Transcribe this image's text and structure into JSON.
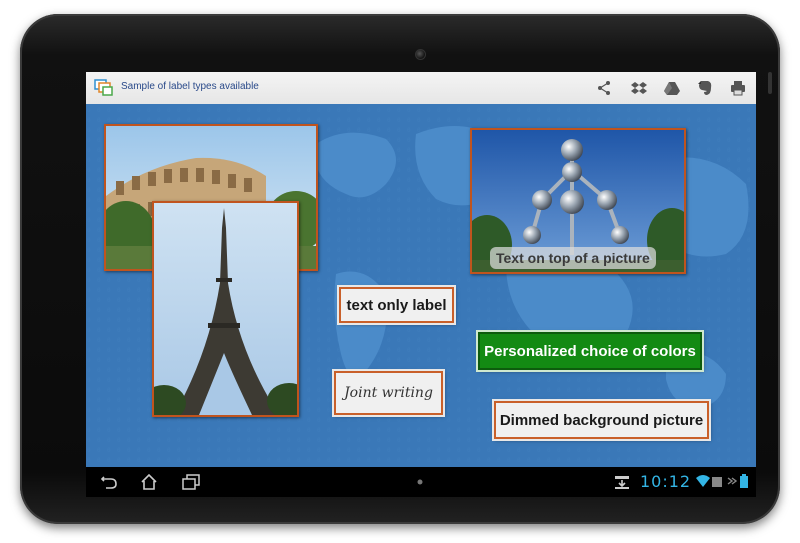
{
  "app": {
    "title": "Sample of label types available"
  },
  "actionbar_icons": [
    "share-icon",
    "dropbox-icon",
    "drive-icon",
    "evernote-icon",
    "print-icon"
  ],
  "labels": {
    "text_only": "text only label",
    "overlay": "Text on top of a picture",
    "colors": "Personalized choice of colors",
    "script": "Joint writing",
    "dimmed": "Dimmed background picture"
  },
  "photos": [
    "colosseum-photo",
    "eiffel-tower-photo",
    "atomium-photo"
  ],
  "status": {
    "time": "10:12"
  },
  "colors": {
    "background": "#3a78b8",
    "frame_border": "#c0541e",
    "green_label": "#138a13",
    "clock": "#33b5e5"
  }
}
